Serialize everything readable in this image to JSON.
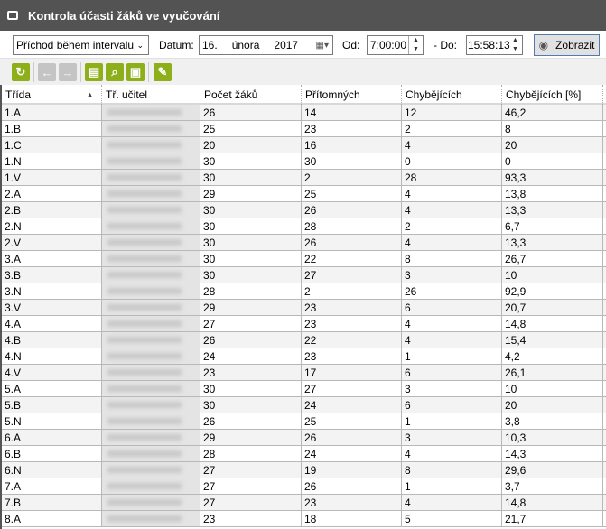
{
  "window": {
    "title": "Kontrola účasti žáků ve vyučování"
  },
  "filters": {
    "mode": "Příchod během intervalu",
    "date_label": "Datum:",
    "date_day": "16.",
    "date_month": "února",
    "date_year": "2017",
    "from_label": "Od:",
    "from": "7:00:00",
    "to_label": "- Do:",
    "to": "15:58:13",
    "show_button": "Zobrazit"
  },
  "columns": [
    "Třída",
    "Tř. učitel",
    "Počet žáků",
    "Přítomných",
    "Chybějících",
    "Chybějících [%]"
  ],
  "rows": [
    [
      "1.A",
      26,
      14,
      12,
      "46,2"
    ],
    [
      "1.B",
      25,
      23,
      2,
      "8"
    ],
    [
      "1.C",
      20,
      16,
      4,
      "20"
    ],
    [
      "1.N",
      30,
      30,
      0,
      "0"
    ],
    [
      "1.V",
      30,
      2,
      28,
      "93,3"
    ],
    [
      "2.A",
      29,
      25,
      4,
      "13,8"
    ],
    [
      "2.B",
      30,
      26,
      4,
      "13,3"
    ],
    [
      "2.N",
      30,
      28,
      2,
      "6,7"
    ],
    [
      "2.V",
      30,
      26,
      4,
      "13,3"
    ],
    [
      "3.A",
      30,
      22,
      8,
      "26,7"
    ],
    [
      "3.B",
      30,
      27,
      3,
      "10"
    ],
    [
      "3.N",
      28,
      2,
      26,
      "92,9"
    ],
    [
      "3.V",
      29,
      23,
      6,
      "20,7"
    ],
    [
      "4.A",
      27,
      23,
      4,
      "14,8"
    ],
    [
      "4.B",
      26,
      22,
      4,
      "15,4"
    ],
    [
      "4.N",
      24,
      23,
      1,
      "4,2"
    ],
    [
      "4.V",
      23,
      17,
      6,
      "26,1"
    ],
    [
      "5.A",
      30,
      27,
      3,
      "10"
    ],
    [
      "5.B",
      30,
      24,
      6,
      "20"
    ],
    [
      "5.N",
      26,
      25,
      1,
      "3,8"
    ],
    [
      "6.A",
      29,
      26,
      3,
      "10,3"
    ],
    [
      "6.B",
      28,
      24,
      4,
      "14,3"
    ],
    [
      "6.N",
      27,
      19,
      8,
      "29,6"
    ],
    [
      "7.A",
      27,
      26,
      1,
      "3,7"
    ],
    [
      "7.B",
      27,
      23,
      4,
      "14,8"
    ],
    [
      "8.A",
      23,
      18,
      5,
      "21,7"
    ]
  ],
  "colors": {
    "accent": "#8caf1a",
    "titlebar": "#535353"
  }
}
